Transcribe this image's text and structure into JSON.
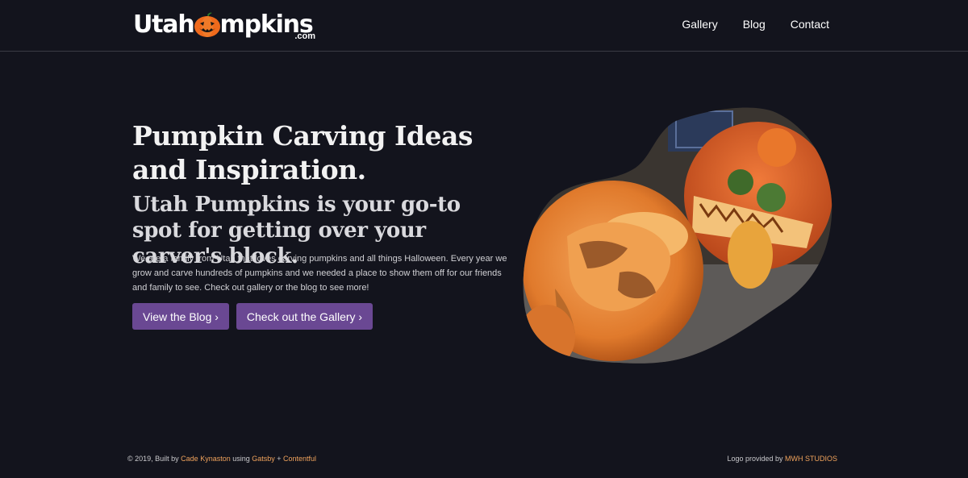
{
  "header": {
    "logo": {
      "part1": "Utah",
      "part2": "mpkins",
      "suffix": ".com",
      "icon": "jack-o-lantern-icon"
    },
    "nav": [
      {
        "label": "Gallery"
      },
      {
        "label": "Blog"
      },
      {
        "label": "Contact"
      }
    ]
  },
  "hero": {
    "title": "Pumpkin Carving Ideas and Inspiration.",
    "subtitle": "Utah Pumpkins is your go-to spot for getting over your carver's block.",
    "body": "We are a family from Utah that loves carving pumpkins and all things Halloween. Every year we grow and carve hundreds of pumpkins and we needed a place to show them off for our friends and family to see. Check out gallery or the blog to see more!",
    "buttons": {
      "blog": "View the Blog ›",
      "gallery": "Check out the Gallery ›"
    }
  },
  "footer": {
    "left": {
      "prefix": "© 2019, Built by ",
      "author": "Cade Kynaston",
      "using": " using ",
      "tech1": "Gatsby",
      "plus": " + ",
      "tech2": "Contentful"
    },
    "right": {
      "prefix": "Logo provided by ",
      "studio": "MWH STUDIOS"
    }
  },
  "colors": {
    "background": "#13141d",
    "button": "#6a4893",
    "footer_link": "#f0a35c"
  }
}
